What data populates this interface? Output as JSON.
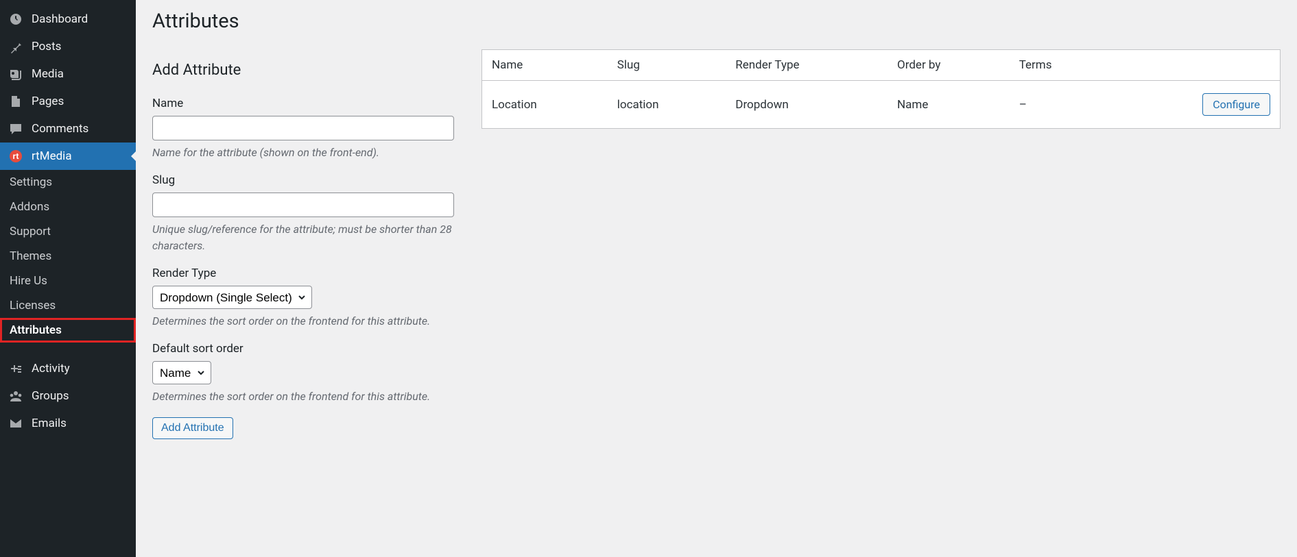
{
  "sidebar": {
    "main": [
      {
        "id": "dashboard",
        "label": "Dashboard",
        "icon": "gauge"
      },
      {
        "id": "posts",
        "label": "Posts",
        "icon": "pin"
      },
      {
        "id": "media",
        "label": "Media",
        "icon": "media"
      },
      {
        "id": "pages",
        "label": "Pages",
        "icon": "page"
      },
      {
        "id": "comments",
        "label": "Comments",
        "icon": "comment"
      },
      {
        "id": "rtmedia",
        "label": "rtMedia",
        "icon": "rtmedia",
        "active": true
      }
    ],
    "sub": [
      {
        "id": "settings",
        "label": "Settings"
      },
      {
        "id": "addons",
        "label": "Addons"
      },
      {
        "id": "support",
        "label": "Support"
      },
      {
        "id": "themes",
        "label": "Themes"
      },
      {
        "id": "hireus",
        "label": "Hire Us"
      },
      {
        "id": "licenses",
        "label": "Licenses"
      },
      {
        "id": "attributes",
        "label": "Attributes",
        "selected": true
      }
    ],
    "tail": [
      {
        "id": "activity",
        "label": "Activity",
        "icon": "plus"
      },
      {
        "id": "groups",
        "label": "Groups",
        "icon": "groups"
      },
      {
        "id": "emails",
        "label": "Emails",
        "icon": "mail"
      }
    ]
  },
  "page": {
    "title": "Attributes",
    "subtitle": "Add Attribute"
  },
  "form": {
    "name": {
      "label": "Name",
      "value": "",
      "hint": "Name for the attribute (shown on the front-end)."
    },
    "slug": {
      "label": "Slug",
      "value": "",
      "hint": "Unique slug/reference for the attribute; must be shorter than 28 characters."
    },
    "render_type": {
      "label": "Render Type",
      "value": "Dropdown (Single Select)",
      "hint": "Determines the sort order on the frontend for this attribute."
    },
    "sort_order": {
      "label": "Default sort order",
      "value": "Name",
      "hint": "Determines the sort order on the frontend for this attribute."
    },
    "submit": "Add Attribute"
  },
  "table": {
    "headers": [
      "Name",
      "Slug",
      "Render Type",
      "Order by",
      "Terms"
    ],
    "rows": [
      {
        "name": "Location",
        "slug": "location",
        "render_type": "Dropdown",
        "order_by": "Name",
        "terms": "–",
        "action": "Configure"
      }
    ]
  }
}
